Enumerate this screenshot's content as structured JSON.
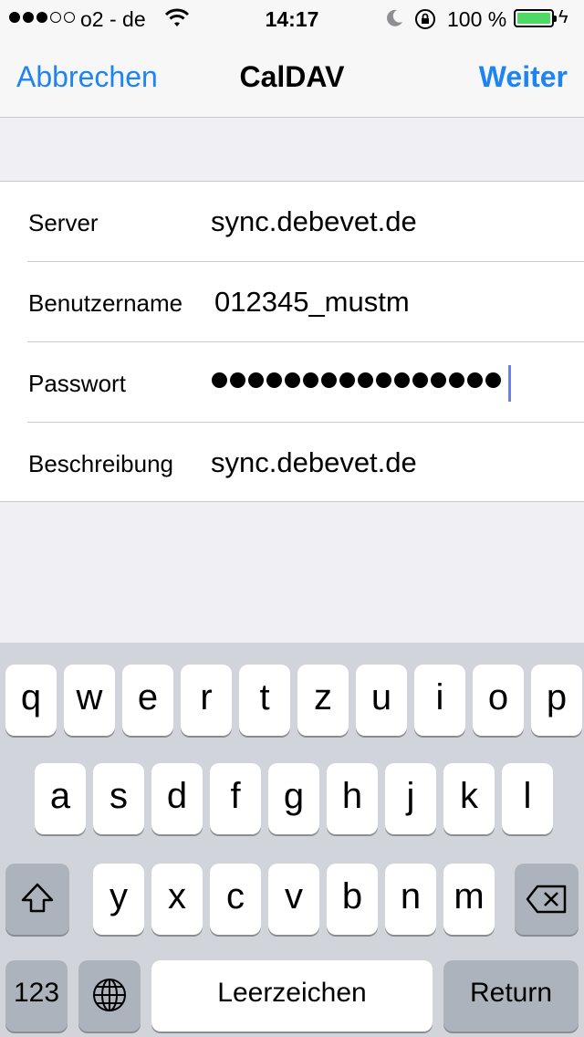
{
  "status_bar": {
    "carrier": "o2 - de",
    "time": "14:17",
    "battery": "100 %",
    "battery_level": 1.0,
    "signal_bars_filled": 3,
    "signal_bars_total": 5
  },
  "nav": {
    "cancel_label": "Abbrechen",
    "title": "CalDAV",
    "next_label": "Weiter"
  },
  "form": {
    "fields": [
      {
        "label": "Server",
        "value": "sync.debevet.de"
      },
      {
        "label": "Benutzername",
        "value": "012345_mustm"
      },
      {
        "label": "Passwort",
        "value": "",
        "masked_length": 16
      },
      {
        "label": "Beschreibung",
        "value": "sync.debevet.de"
      }
    ]
  },
  "keyboard": {
    "row1": [
      "q",
      "w",
      "e",
      "r",
      "t",
      "z",
      "u",
      "i",
      "o",
      "p"
    ],
    "row2": [
      "a",
      "s",
      "d",
      "f",
      "g",
      "h",
      "j",
      "k",
      "l"
    ],
    "row3": [
      "y",
      "x",
      "c",
      "v",
      "b",
      "n",
      "m"
    ],
    "numbers_label": "123",
    "space_label": "Leerzeichen",
    "return_label": "Return"
  },
  "colors": {
    "accent": "#1e84f0",
    "battery": "#4cd964",
    "caret": "#6b7ff2"
  }
}
